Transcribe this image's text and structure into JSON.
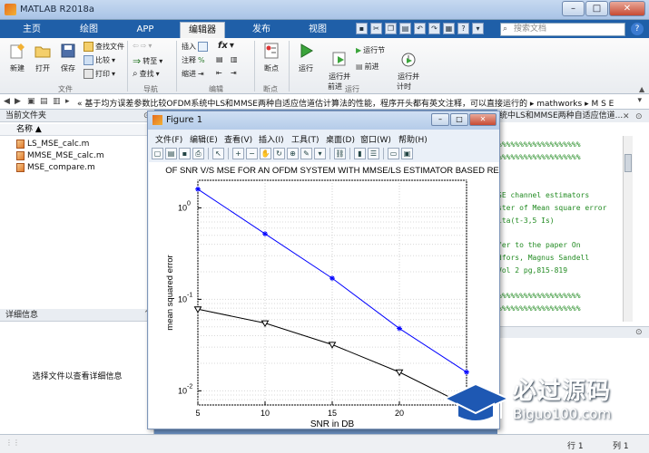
{
  "window": {
    "title": "MATLAB R2018a",
    "min": "–",
    "max": "□",
    "close": "✕"
  },
  "tabs": [
    {
      "label": "主页"
    },
    {
      "label": "绘图"
    },
    {
      "label": "APP"
    },
    {
      "label": "编辑器"
    },
    {
      "label": "发布"
    },
    {
      "label": "视图"
    }
  ],
  "search": {
    "placeholder": "搜索文档"
  },
  "ribbon": {
    "new": "新建",
    "open": "打开",
    "save": "保存",
    "find_files": "查找文件",
    "compare": "比较",
    "print": "打印",
    "goto": "转至",
    "find": "查找",
    "insert": "插入",
    "comment": "注释",
    "indent": "缩进",
    "fx": "fx",
    "breakpoints": "断点",
    "run": "运行",
    "run_advance": "运行并\n前进",
    "run_section": "运行节",
    "advance": "前进",
    "run_time": "运行并\n计时",
    "groups": {
      "file": "文件",
      "navigate": "导航",
      "edit": "编辑",
      "breakpoints": "断点",
      "run": "运行"
    }
  },
  "address": {
    "path": "«  基于均方误差参数比较OFDM系统中LS和MMSE两种自适应信道估计算法的性能，程序开头都有英文注释，可以直接运行的  ▸  mathworks  ▸  M S E"
  },
  "current_folder": {
    "title": "当前文件夹",
    "col_name": "名称 ▲",
    "files": [
      "LS_MSE_calc.m",
      "MMSE_MSE_calc.m",
      "MSE_compare.m"
    ]
  },
  "details": {
    "title": "详细信息",
    "text": "选择文件以查看详细信息"
  },
  "editor": {
    "tab": "统中LS和MMSE两种自适应信道...",
    "lines": [
      "%%%%%%%%%%%%%%%%%%%",
      "%%%%%%%%%%%%%%%%%%%",
      "",
      "",
      "SE channel estimators",
      "ster of Mean square error",
      "ita(t-3,5 Is)",
      "",
      "",
      "fer to the paper On",
      "dfors, Magnus Sandell",
      "Vol 2 pg,815-819",
      "",
      "%%%%%%%%%%%%%%%%%%%",
      "%%%%%%%%%%%%%%%%%%%"
    ]
  },
  "status": {
    "ln_label": "行",
    "ln": "1",
    "col_label": "列",
    "col": "1"
  },
  "figure": {
    "title": "Figure 1",
    "menu": [
      "文件(F)",
      "编辑(E)",
      "查看(V)",
      "插入(I)",
      "工具(T)",
      "桌面(D)",
      "窗口(W)",
      "帮助(H)"
    ]
  },
  "chart_data": {
    "type": "line",
    "title": "OF SNR V/S MSE FOR AN OFDM SYSTEM WITH MMSE/LS ESTIMATOR BASED RE",
    "xlabel": "SNR in DB",
    "ylabel": "mean squared error",
    "x": [
      5,
      10,
      15,
      20,
      25
    ],
    "xlim": [
      5,
      25
    ],
    "ylim": [
      0.007,
      2
    ],
    "yscale": "log",
    "xticks": [
      "5",
      "10",
      "15",
      "20",
      "25"
    ],
    "yticks": [
      {
        "value": 1,
        "label": "10",
        "exp": "0"
      },
      {
        "value": 0.1,
        "label": "10",
        "exp": "-1"
      },
      {
        "value": 0.01,
        "label": "10",
        "exp": "-2"
      }
    ],
    "grid": true,
    "series": [
      {
        "color": "#0000ff",
        "marker": "star",
        "values": [
          1.6,
          0.52,
          0.17,
          0.048,
          0.016
        ]
      },
      {
        "color": "#000000",
        "marker": "triangle-down",
        "values": [
          0.078,
          0.055,
          0.032,
          0.016,
          0.0069
        ]
      }
    ]
  },
  "watermark": {
    "cn": "必过源码",
    "en": "Biguo100.com"
  }
}
